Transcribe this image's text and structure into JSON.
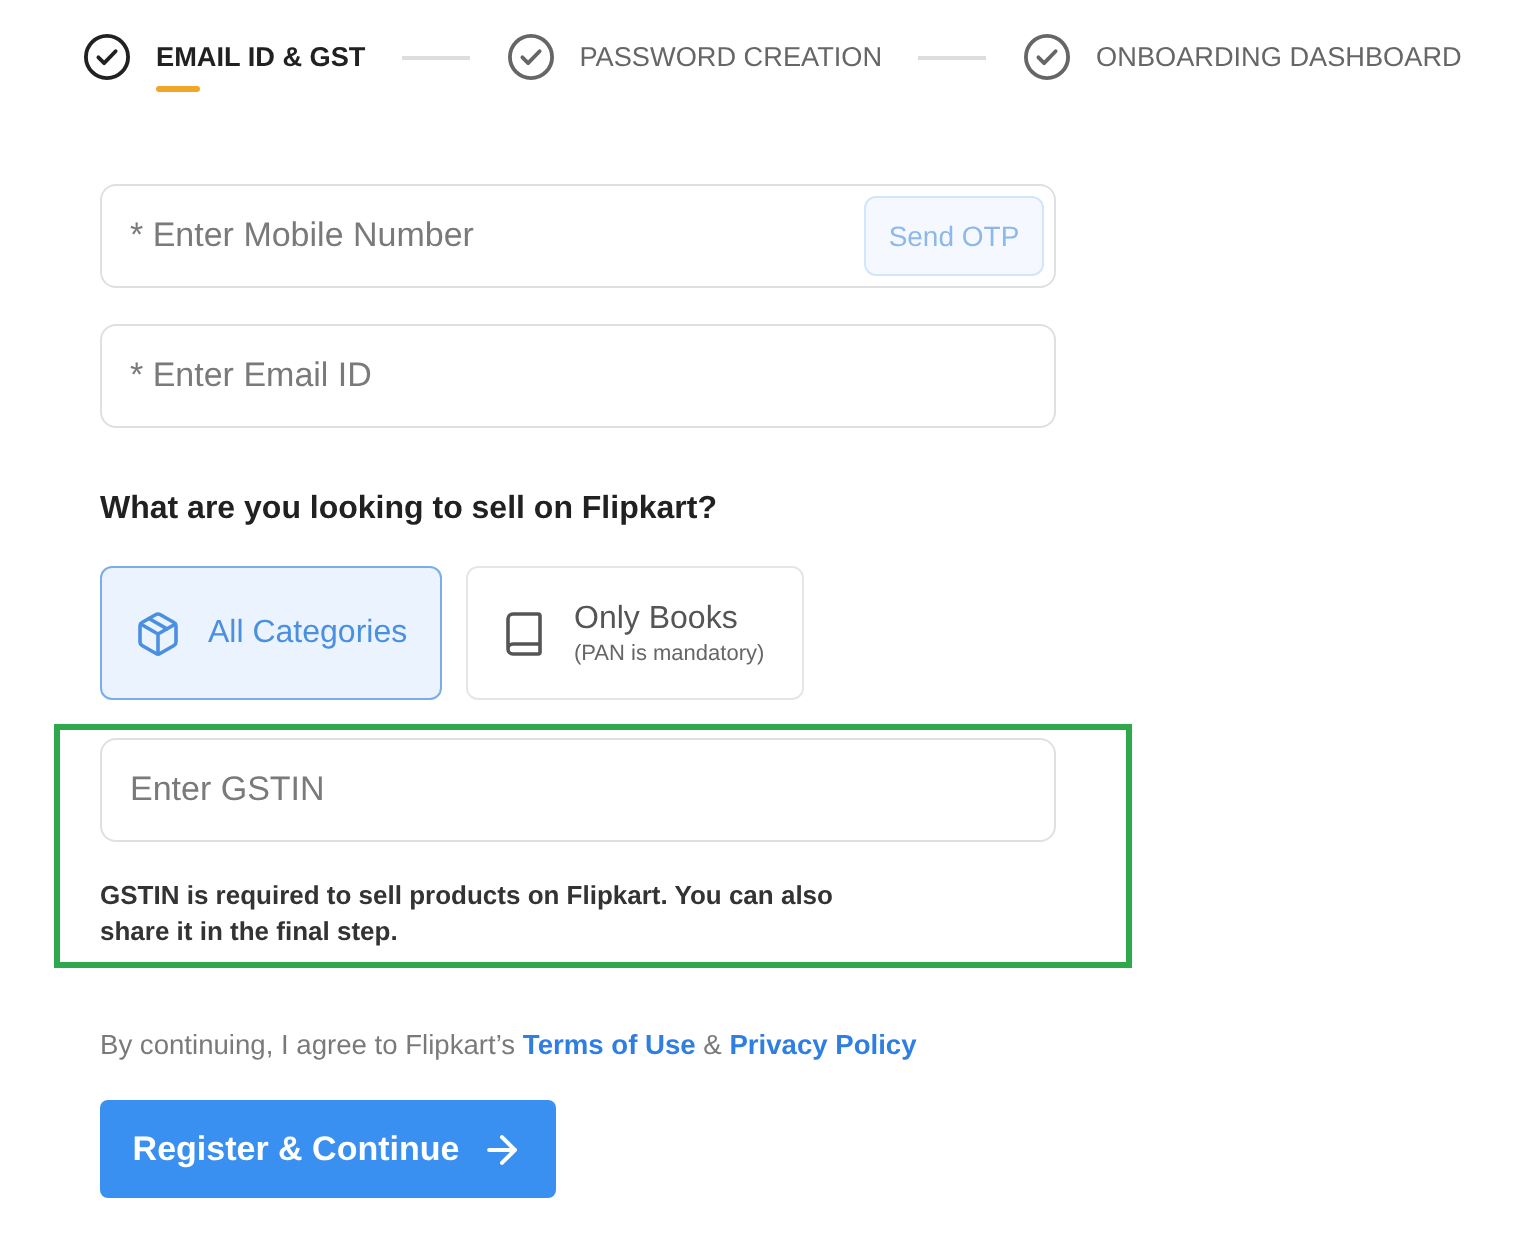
{
  "stepper": {
    "steps": [
      {
        "label": "EMAIL ID & GST",
        "selected": true
      },
      {
        "label": "PASSWORD CREATION",
        "selected": false
      },
      {
        "label": "ONBOARDING DASHBOARD",
        "selected": false
      }
    ]
  },
  "mobile": {
    "placeholder": "* Enter Mobile Number",
    "otp_button": {
      "label": "Send OTP",
      "disabled": true
    }
  },
  "email": {
    "placeholder": "* Enter Email ID"
  },
  "category_question": "What are you looking to sell on Flipkart?",
  "categories": [
    {
      "kind": "box",
      "label": "All Categories",
      "selected": true
    },
    {
      "kind": "book",
      "label": "Only Books",
      "note": "(PAN is mandatory)",
      "selected": false
    }
  ],
  "gstin": {
    "placeholder": "Enter GSTIN",
    "help": "GSTIN is required to sell products on Flipkart. You can also share it in the final step."
  },
  "consent": {
    "prefix": "By continuing, I agree to Flipkart’s",
    "terms_link": "Terms of Use",
    "joiner": "&",
    "privacy_link": "Privacy Policy"
  },
  "submit_button": {
    "label": "Register & Continue"
  }
}
